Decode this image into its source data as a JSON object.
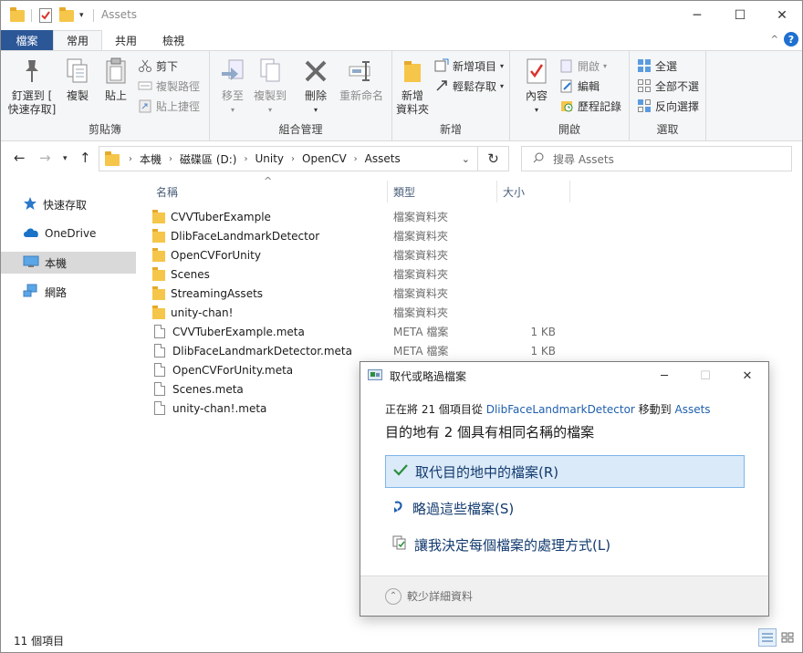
{
  "window": {
    "title": "Assets",
    "controls": {
      "minimize": "─",
      "maximize": "☐",
      "close": "✕"
    }
  },
  "ribbon": {
    "tabs": [
      {
        "label": "檔案"
      },
      {
        "label": "常用"
      },
      {
        "label": "共用"
      },
      {
        "label": "檢視"
      }
    ],
    "groups": {
      "clipboard": {
        "label": "剪貼簿",
        "pin": "釘選到 [\n快速存取]",
        "copy": "複製",
        "paste": "貼上",
        "cut": "剪下",
        "copy_path": "複製路徑",
        "paste_shortcut": "貼上捷徑"
      },
      "organize": {
        "label": "組合管理",
        "move_to": "移至",
        "copy_to": "複製到",
        "delete": "刪除",
        "rename": "重新命名"
      },
      "new": {
        "label": "新增",
        "new_folder": "新增\n資料夾",
        "new_item": "新增項目",
        "easy_access": "輕鬆存取"
      },
      "open": {
        "label": "開啟",
        "properties": "內容",
        "open": "開啟",
        "edit": "編輯",
        "history": "歷程記錄"
      },
      "select": {
        "label": "選取",
        "select_all": "全選",
        "select_none": "全部不選",
        "invert": "反向選擇"
      }
    }
  },
  "address": {
    "crumbs": [
      "本機",
      "磁碟區 (D:)",
      "Unity",
      "OpenCV",
      "Assets"
    ],
    "search_placeholder": "搜尋 Assets"
  },
  "nav_pane": {
    "items": [
      {
        "label": "快速存取"
      },
      {
        "label": "OneDrive"
      },
      {
        "label": "本機"
      },
      {
        "label": "網路"
      }
    ]
  },
  "columns": {
    "name": "名稱",
    "type": "類型",
    "size": "大小"
  },
  "files": [
    {
      "name": "CVVTuberExample",
      "type": "檔案資料夾",
      "size": "",
      "kind": "folder"
    },
    {
      "name": "DlibFaceLandmarkDetector",
      "type": "檔案資料夾",
      "size": "",
      "kind": "folder"
    },
    {
      "name": "OpenCVForUnity",
      "type": "檔案資料夾",
      "size": "",
      "kind": "folder"
    },
    {
      "name": "Scenes",
      "type": "檔案資料夾",
      "size": "",
      "kind": "folder"
    },
    {
      "name": "StreamingAssets",
      "type": "檔案資料夾",
      "size": "",
      "kind": "folder"
    },
    {
      "name": "unity-chan!",
      "type": "檔案資料夾",
      "size": "",
      "kind": "folder"
    },
    {
      "name": "CVVTuberExample.meta",
      "type": "META 檔案",
      "size": "1 KB",
      "kind": "file"
    },
    {
      "name": "DlibFaceLandmarkDetector.meta",
      "type": "META 檔案",
      "size": "1 KB",
      "kind": "file"
    },
    {
      "name": "OpenCVForUnity.meta",
      "type": "",
      "size": "",
      "kind": "file"
    },
    {
      "name": "Scenes.meta",
      "type": "",
      "size": "",
      "kind": "file"
    },
    {
      "name": "unity-chan!.meta",
      "type": "",
      "size": "",
      "kind": "file"
    }
  ],
  "status": {
    "count": "11 個項目"
  },
  "dialog": {
    "title": "取代或略過檔案",
    "line_prefix": "正在將 21 個項目從 ",
    "source": "DlibFaceLandmarkDetector",
    "line_middle": " 移動到 ",
    "destination": "Assets",
    "heading": "目的地有 2 個具有相同名稱的檔案",
    "options": [
      {
        "label": "取代目的地中的檔案(R)"
      },
      {
        "label": "略過這些檔案(S)"
      },
      {
        "label": "讓我決定每個檔案的處理方式(L)"
      }
    ],
    "fewer_details": "較少詳細資料"
  },
  "colors": {
    "accent": "#1f5fae",
    "file_tab": "#2b5797",
    "folder": "#f6c64a"
  }
}
